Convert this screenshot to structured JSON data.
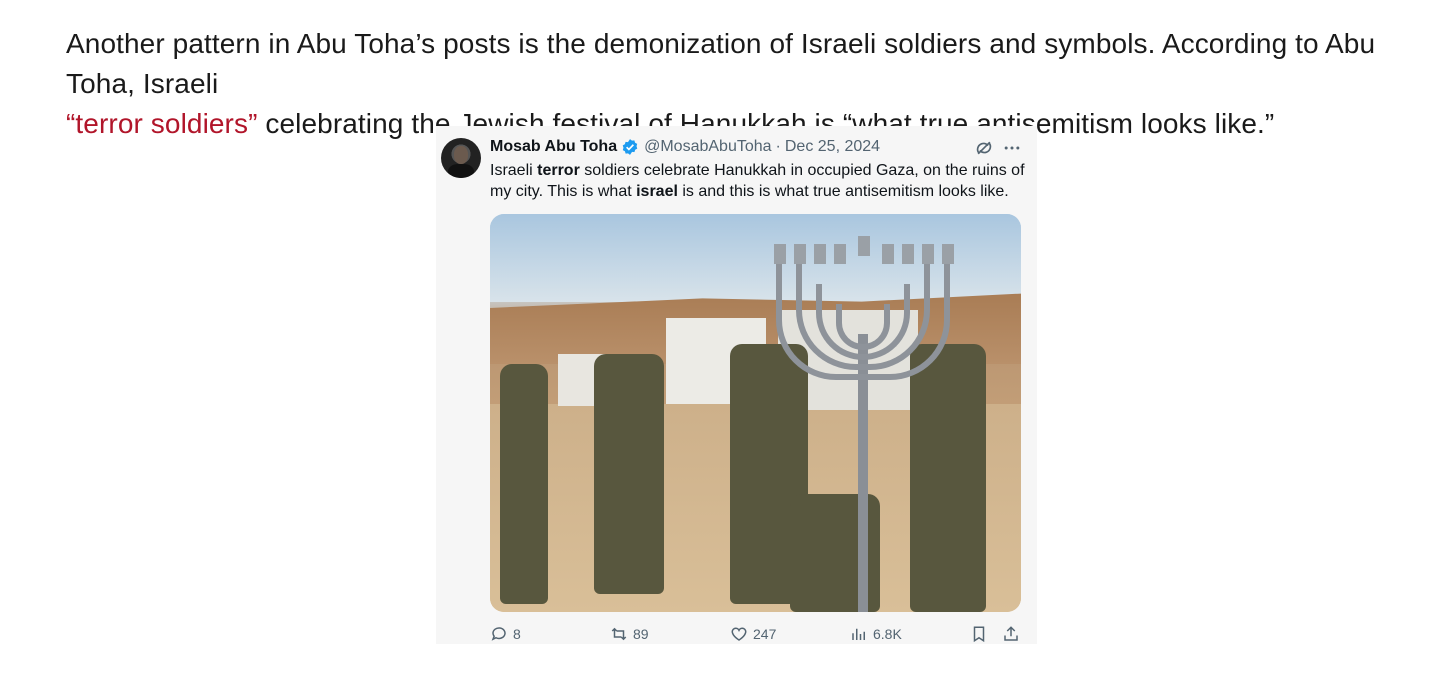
{
  "article": {
    "line1": "Another pattern in Abu Toha’s posts is the demonization of Israeli soldiers and symbols. According to Abu Toha, Israeli",
    "highlight": "“terror soldiers”",
    "line2_rest": " celebrating the Jewish festival of Hanukkah is “what true antisemitism looks like.”"
  },
  "tweet": {
    "author_name": "Mosab Abu Toha",
    "handle": "@MosabAbuToha",
    "separator": "·",
    "date": "Dec 25, 2024",
    "text": {
      "p1": "Israeli ",
      "b1": "terror",
      "p2": " soldiers celebrate Hanukkah in occupied Gaza, on the ruins of my city. This is what ",
      "b2": "israel",
      "p3": " is and this is what true antisemitism looks like."
    },
    "actions": {
      "replies": "8",
      "reposts": "89",
      "likes": "247",
      "views": "6.8K"
    },
    "icons": {
      "verified": "verified-badge-icon",
      "grok": "grok-icon",
      "more": "more-icon",
      "reply": "reply-icon",
      "repost": "repost-icon",
      "like": "like-icon",
      "views": "views-icon",
      "bookmark": "bookmark-icon",
      "share": "share-icon"
    },
    "colors": {
      "highlight_red": "#b1152a",
      "verified_blue": "#1d9bf0",
      "muted_text": "#536471"
    }
  }
}
